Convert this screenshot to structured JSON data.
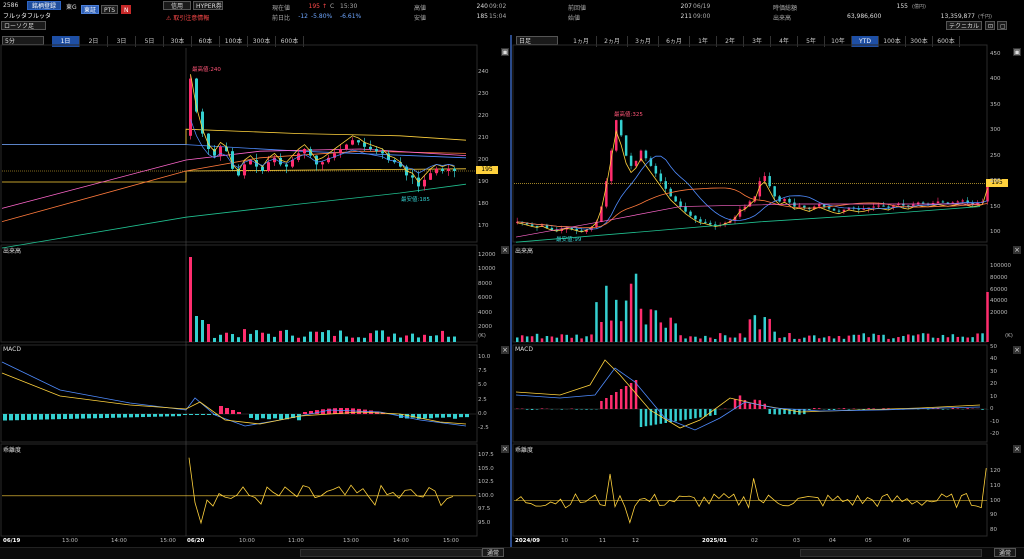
{
  "stock": {
    "code": "2586",
    "tab_label": "銘柄登録",
    "market": "東G",
    "name": "フルッタフルッタ",
    "exchange_btn": "東証",
    "pts_btn": "PTS",
    "n_icon": "N",
    "credit_btn": "信用",
    "hyper_btn": "HYPER券",
    "notice": "⚠ 取引注意情報",
    "chart_type": "ローソク足",
    "quote": {
      "current_label": "現在値",
      "current": "195",
      "current_mark": "↑",
      "current_flag": "C",
      "current_time": "15:30",
      "prev_label": "前日比",
      "change": "-12",
      "change_pct": "-5.80%",
      "change_pct2": "-6.61%",
      "high_label": "高値",
      "high": "240",
      "high_time": "09:02",
      "low_label": "安値",
      "low": "185",
      "low_time": "15:04",
      "prevclose_label": "前回値",
      "prevclose": "207",
      "prevclose_date": "06/19",
      "open_label": "始値",
      "open": "211",
      "open_time": "09:00",
      "mcap_label": "時価総額",
      "mcap": "155",
      "mcap_unit": "(億円)",
      "volume_label": "出来高",
      "volume": "63,986,600",
      "turnover": "13,359,877",
      "turnover_unit": "(千円)",
      "technical_btn": "テクニカル"
    }
  },
  "left": {
    "interval": "5分",
    "periods": [
      "1日",
      "2日",
      "3日",
      "5日",
      "30本",
      "60本",
      "100本",
      "300本",
      "600本"
    ],
    "selected_period": "1日",
    "price_axis": [
      "240",
      "230",
      "220",
      "210",
      "200",
      "190",
      "180",
      "170"
    ],
    "price_tag": "195",
    "high_annot": "最高値:240",
    "low_annot": "最安値:185",
    "vol_title": "出来高",
    "vol_axis": [
      "12000",
      "10000",
      "8000",
      "6000",
      "4000",
      "2000"
    ],
    "vol_unit": "(K)",
    "macd_title": "MACD",
    "macd_axis": [
      "10.0",
      "7.5",
      "5.0",
      "2.5",
      "0.0",
      "-2.5"
    ],
    "dev_title": "乖離度",
    "dev_axis": [
      "107.5",
      "105.0",
      "102.5",
      "100.0",
      "97.5",
      "95.0"
    ],
    "time_axis": [
      {
        "label": "06/19",
        "bold": true
      },
      {
        "label": "13:00",
        "bold": false
      },
      {
        "label": "14:00",
        "bold": false
      },
      {
        "label": "15:00",
        "bold": false
      },
      {
        "label": "06/20",
        "bold": true
      },
      {
        "label": "10:00",
        "bold": false
      },
      {
        "label": "11:00",
        "bold": false
      },
      {
        "label": "13:00",
        "bold": false
      },
      {
        "label": "14:00",
        "bold": false
      },
      {
        "label": "15:00",
        "bold": false
      }
    ]
  },
  "right": {
    "interval": "日足",
    "periods": [
      "1ヵ月",
      "2ヵ月",
      "3ヵ月",
      "6ヵ月",
      "1年",
      "2年",
      "3年",
      "4年",
      "5年",
      "10年",
      "YTD",
      "100本",
      "300本",
      "600本"
    ],
    "selected_period": "YTD",
    "price_axis": [
      "450",
      "400",
      "350",
      "300",
      "250",
      "200",
      "150",
      "100"
    ],
    "price_tag": "195",
    "high_annot": "最高値:325",
    "low_annot": "最安値:99",
    "vol_title": "出来高",
    "vol_axis": [
      "100000",
      "80000",
      "60000",
      "40000",
      "20000"
    ],
    "vol_unit": "(K)",
    "macd_title": "MACD",
    "macd_axis": [
      "50",
      "40",
      "30",
      "20",
      "10",
      "0",
      "-10",
      "-20"
    ],
    "dev_title": "乖離度",
    "dev_axis": [
      "120",
      "110",
      "100",
      "90",
      "80"
    ],
    "time_axis": [
      {
        "label": "2024/09",
        "bold": true
      },
      {
        "label": "10",
        "bold": false
      },
      {
        "label": "11",
        "bold": false
      },
      {
        "label": "12",
        "bold": false
      },
      {
        "label": "2025/01",
        "bold": true
      },
      {
        "label": "02",
        "bold": false
      },
      {
        "label": "03",
        "bold": false
      },
      {
        "label": "04",
        "bold": false
      },
      {
        "label": "05",
        "bold": false
      },
      {
        "label": "06",
        "bold": false
      }
    ]
  },
  "bottom": {
    "left_select": "通常",
    "right_select": "通常"
  },
  "colors": {
    "up": "#ff2d6e",
    "down": "#35d0d0",
    "ma_short": "#ffd23d",
    "ma_mid": "#4f8cff",
    "ma_long": "#ff7a3c",
    "ma_xlong": "#20c090",
    "vwap": "#ff66cc",
    "accent": "#2d5fb7"
  }
}
